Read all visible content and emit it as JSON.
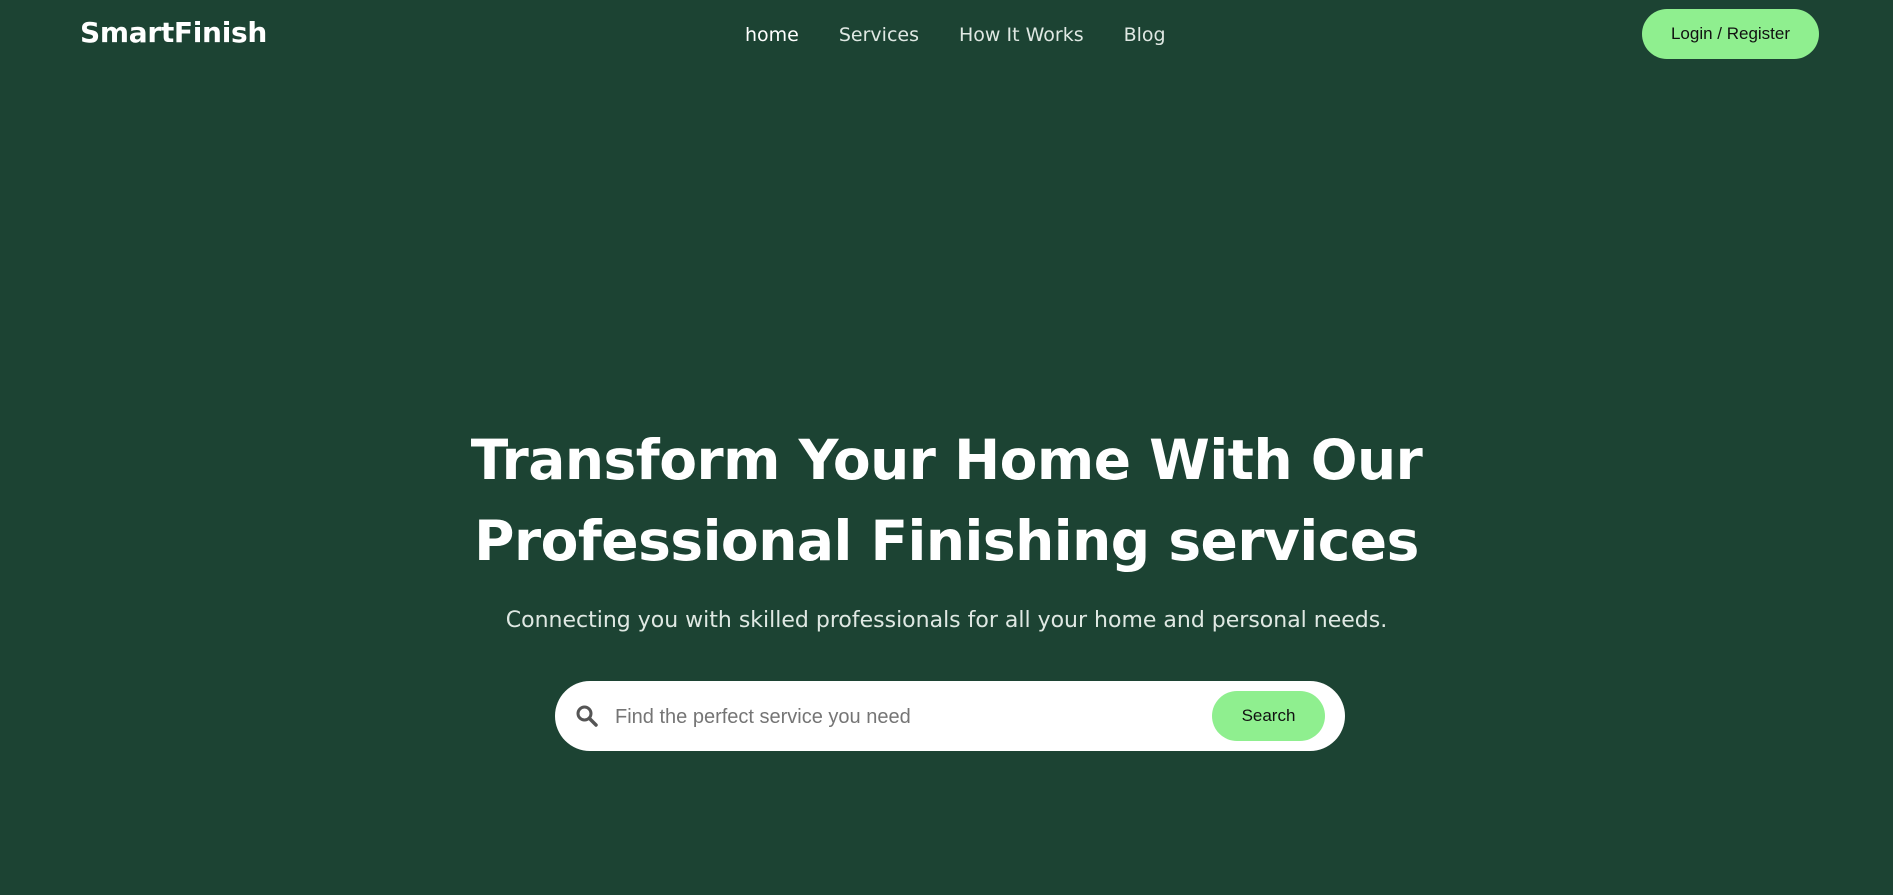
{
  "header": {
    "logo": "SmartFinish",
    "nav": [
      {
        "label": "home",
        "active": true
      },
      {
        "label": "Services",
        "active": false
      },
      {
        "label": "How It Works",
        "active": false
      },
      {
        "label": "Blog",
        "active": false
      }
    ],
    "login_label": "Login / Register"
  },
  "hero": {
    "title_line1": "Transform Your Home With Our",
    "title_line2": "Professional Finishing services",
    "subtitle": "Connecting you with skilled professionals for all your home and personal needs."
  },
  "search": {
    "icon": "search-icon",
    "placeholder": "Find the perfect service you need",
    "value": "",
    "button_label": "Search"
  },
  "colors": {
    "background": "#1c4333",
    "accent": "#8fef8f",
    "text": "#ffffff"
  }
}
